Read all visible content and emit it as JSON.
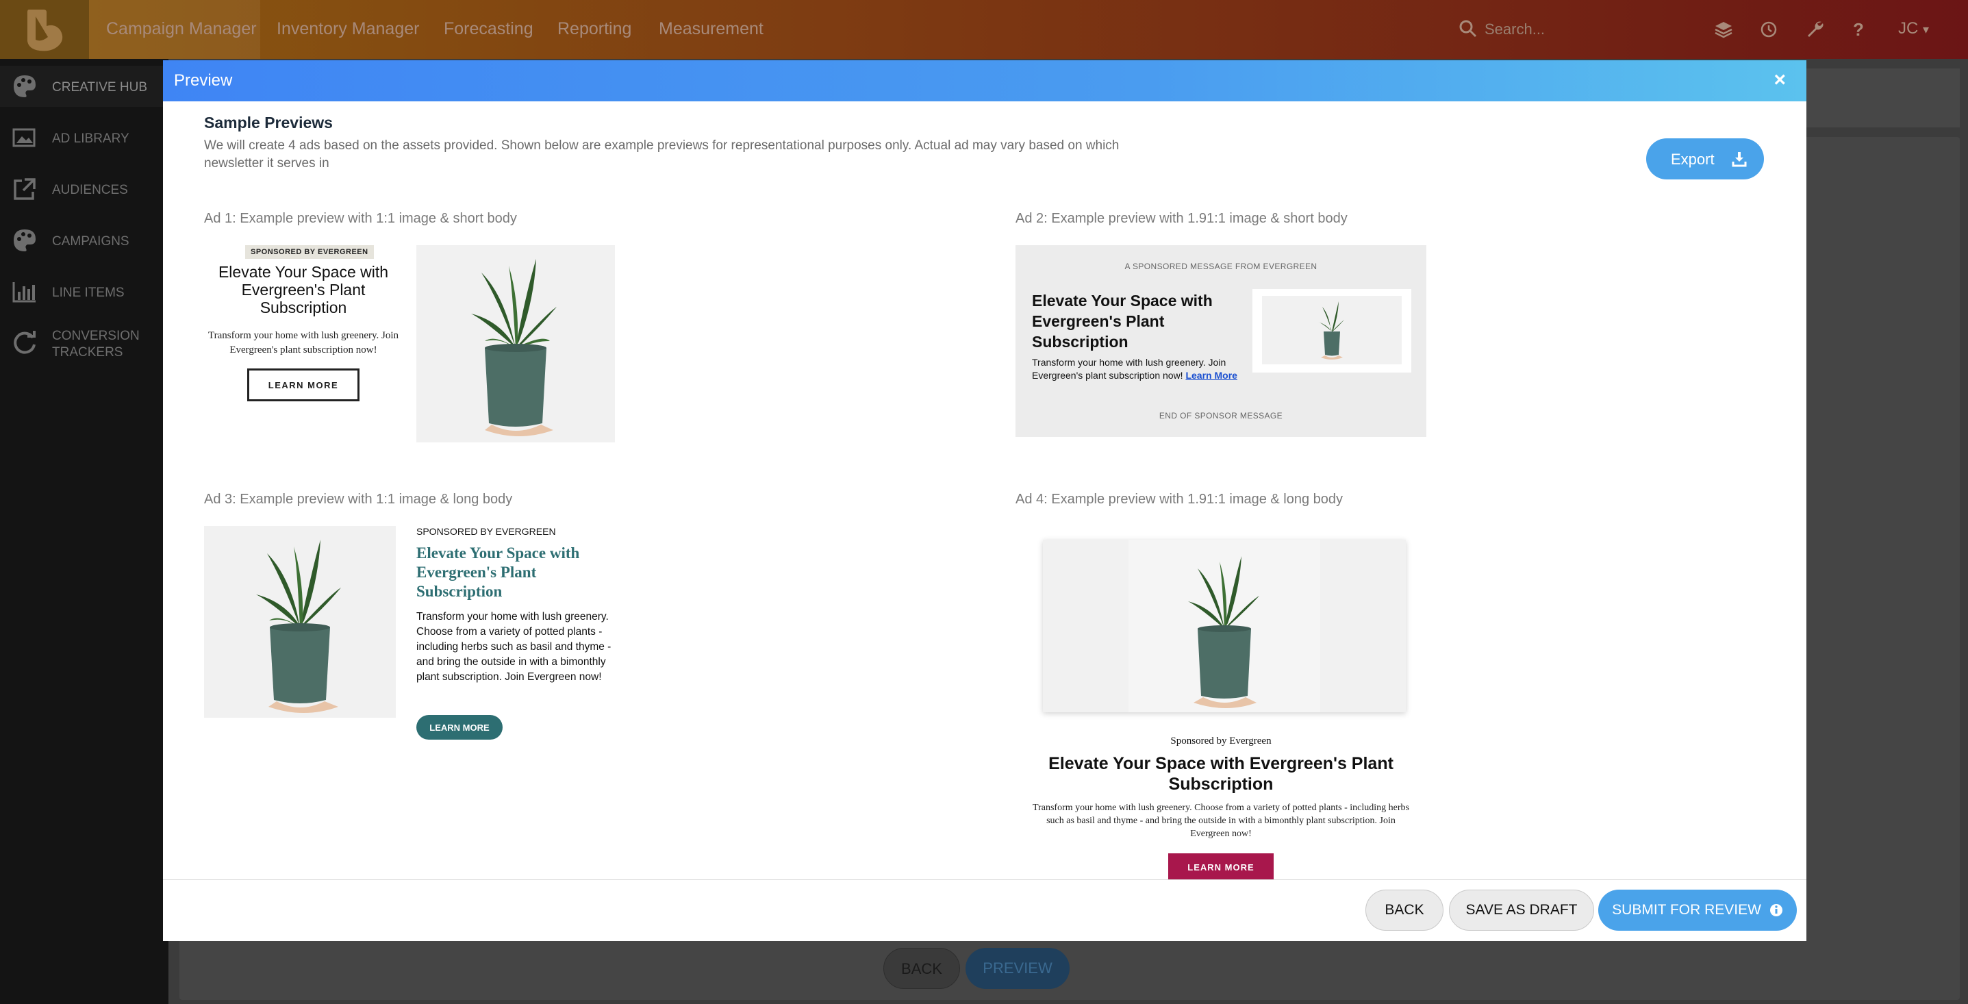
{
  "topnav": {
    "items": [
      "Campaign Manager",
      "Inventory Manager",
      "Forecasting",
      "Reporting",
      "Measurement"
    ],
    "search_placeholder": "Search...",
    "user_initials": "JC"
  },
  "sidebar": {
    "items": [
      {
        "label": "CREATIVE HUB",
        "icon": "palette-icon"
      },
      {
        "label": "AD LIBRARY",
        "icon": "image-library-icon"
      },
      {
        "label": "AUDIENCES",
        "icon": "external-link-icon"
      },
      {
        "label": "CAMPAIGNS",
        "icon": "palette-icon"
      },
      {
        "label": "LINE ITEMS",
        "icon": "bar-chart-icon"
      },
      {
        "label": "CONVERSION",
        "label2": "TRACKERS",
        "icon": "refresh-icon"
      }
    ]
  },
  "background_footer": {
    "back_label": "BACK",
    "preview_label": "PREVIEW"
  },
  "modal": {
    "title": "Preview",
    "close_glyph": "×",
    "sample_title": "Sample Previews",
    "sample_desc": "We will create 4 ads based on the assets provided. Shown below are example previews for representational purposes only. Actual ad may vary based on which newsletter it serves in",
    "export_label": "Export",
    "ads": {
      "ad1": {
        "label": "Ad 1: Example preview with 1:1 image & short body",
        "badge": "SPONSORED BY EVERGREEN",
        "headline": "Elevate Your Space with Evergreen's Plant Subscription",
        "body": "Transform your home with lush greenery. Join Evergreen's plant subscription now!",
        "cta": "LEARN MORE"
      },
      "ad2": {
        "label": "Ad 2: Example preview with 1.91:1 image & short body",
        "top": "A SPONSORED MESSAGE FROM EVERGREEN",
        "headline": "Elevate Your Space with Evergreen's Plant Subscription",
        "body": "Transform your home with lush greenery. Join Evergreen's plant subscription now!",
        "link": "Learn More",
        "bottom": "END OF SPONSOR MESSAGE"
      },
      "ad3": {
        "label": "Ad 3: Example preview with 1:1 image & long body",
        "sponsor": "SPONSORED BY EVERGREEN",
        "headline": "Elevate Your Space with Evergreen's Plant Subscription",
        "body": "Transform your home with lush greenery. Choose from a variety of potted plants - including herbs such as basil and thyme - and bring the outside in with a bimonthly plant subscription. Join Evergreen now!",
        "cta": "LEARN MORE"
      },
      "ad4": {
        "label": "Ad 4: Example preview with 1.91:1 image & long body",
        "sponsor": "Sponsored by Evergreen",
        "headline": "Elevate Your Space with Evergreen's Plant Subscription",
        "body": "Transform your home with lush greenery. Choose from a variety of potted plants - including herbs such as basil and thyme - and bring the outside in with a bimonthly plant subscription. Join Evergreen now!",
        "cta": "LEARN MORE"
      }
    },
    "footer": {
      "back_label": "BACK",
      "draft_label": "SAVE AS DRAFT",
      "submit_label": "SUBMIT FOR REVIEW"
    }
  },
  "colors": {
    "modal_header_start": "#3f85f4",
    "modal_header_end": "#5bc2ee",
    "primary_button": "#4aa3ea",
    "ad3_accent": "#2d6e72",
    "ad4_cta": "#a8174c"
  }
}
